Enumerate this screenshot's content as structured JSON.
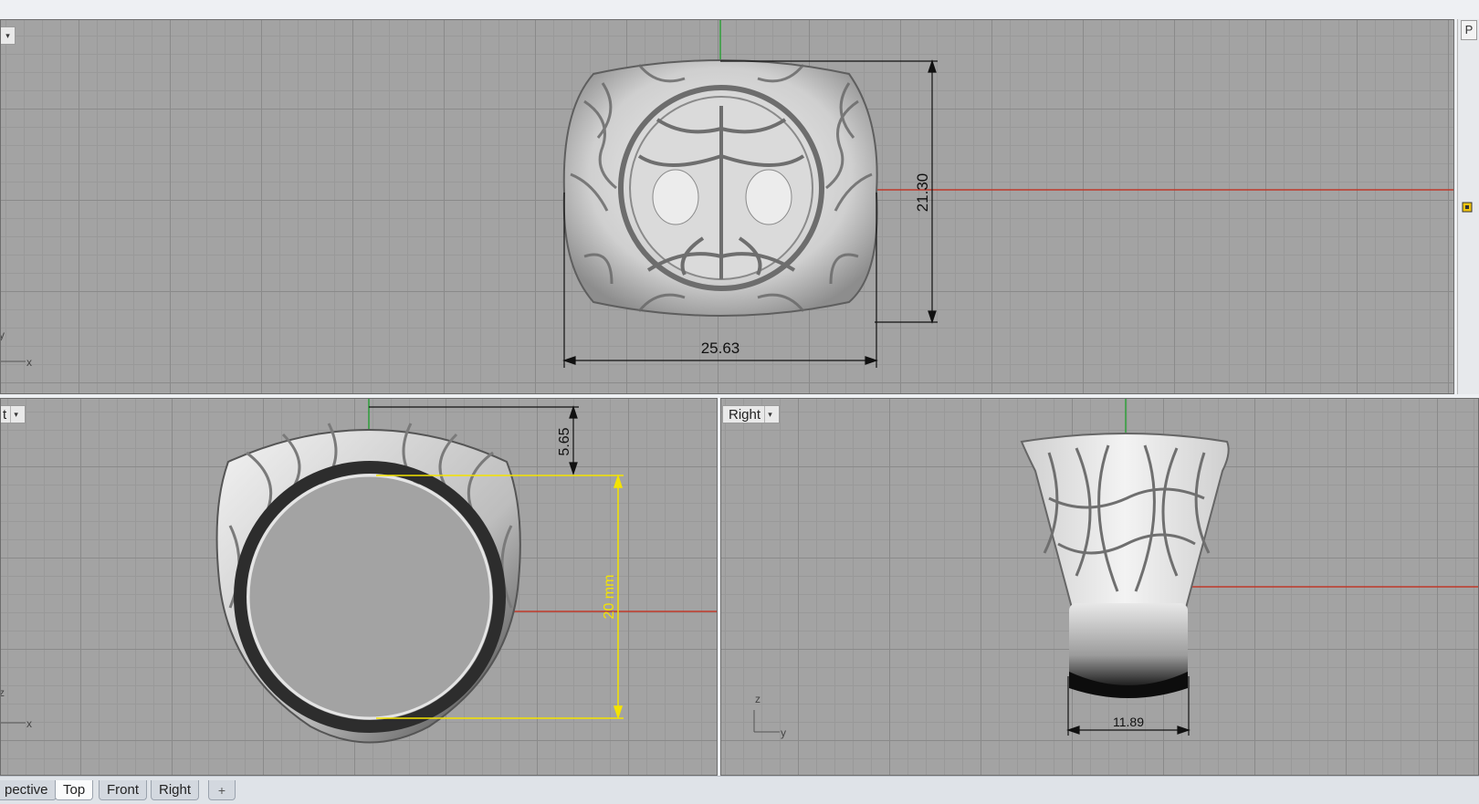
{
  "viewports": {
    "top": {
      "title": ""
    },
    "front": {
      "title": "t"
    },
    "right": {
      "title": "Right"
    }
  },
  "dimensions": {
    "top_width": "25.63",
    "top_height": "21.30",
    "front_head_height": "5.65",
    "front_inner_diameter": "20 mm",
    "right_band_width": "11.89"
  },
  "axes": {
    "top": {
      "a": "y",
      "b": "x"
    },
    "front": {
      "a": "z",
      "b": "x"
    },
    "right": {
      "a": "z",
      "b": "y"
    }
  },
  "side_panel": {
    "label": "P"
  },
  "tabs": [
    "pective",
    "Top",
    "Front",
    "Right"
  ],
  "tab_add": "+",
  "active_tab": "Top",
  "colors": {
    "viewport_bg": "#a3a3a3",
    "x_axis": "#c0392b",
    "y_axis": "#2e9e3a",
    "dimension_highlight": "#f4e300",
    "dimension_line": "#111111"
  }
}
